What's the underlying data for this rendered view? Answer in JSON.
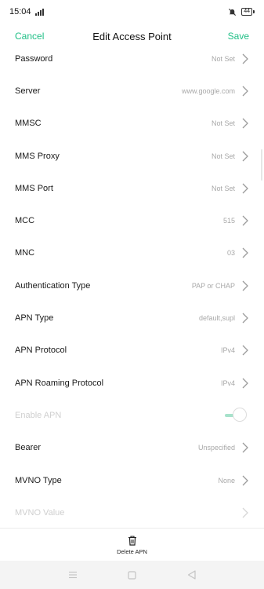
{
  "status_bar": {
    "time": "15:04",
    "battery": "44"
  },
  "toolbar": {
    "cancel_label": "Cancel",
    "title": "Edit Access Point",
    "save_label": "Save"
  },
  "rows": [
    {
      "label": "Password",
      "value": "Not Set"
    },
    {
      "label": "Server",
      "value": "www.google.com"
    },
    {
      "label": "MMSC",
      "value": "Not Set"
    },
    {
      "label": "MMS Proxy",
      "value": "Not Set"
    },
    {
      "label": "MMS Port",
      "value": "Not Set"
    },
    {
      "label": "MCC",
      "value": "515"
    },
    {
      "label": "MNC",
      "value": "03"
    },
    {
      "label": "Authentication Type",
      "value": "PAP or CHAP"
    },
    {
      "label": "APN Type",
      "value": "default,supl"
    },
    {
      "label": "APN Protocol",
      "value": "IPv4"
    },
    {
      "label": "APN Roaming Protocol",
      "value": "IPv4"
    },
    {
      "label": "Enable APN",
      "enabled": true,
      "disabled": true
    },
    {
      "label": "Bearer",
      "value": "Unspecified"
    },
    {
      "label": "MVNO Type",
      "value": "None"
    },
    {
      "label": "MVNO Value",
      "disabled": true
    }
  ],
  "bottom": {
    "delete_label": "Delete APN"
  },
  "colors": {
    "accent": "#1fbf86",
    "value_text": "#a8a8a8",
    "disabled_text": "#cfcfcf"
  },
  "icons": {
    "signal": "signal-icon",
    "mute": "mute-icon",
    "battery": "battery-icon",
    "chevron": "chevron-right-icon",
    "trash": "trash-icon",
    "nav_menu": "menu-icon",
    "nav_home": "home-icon",
    "nav_back": "back-icon"
  }
}
